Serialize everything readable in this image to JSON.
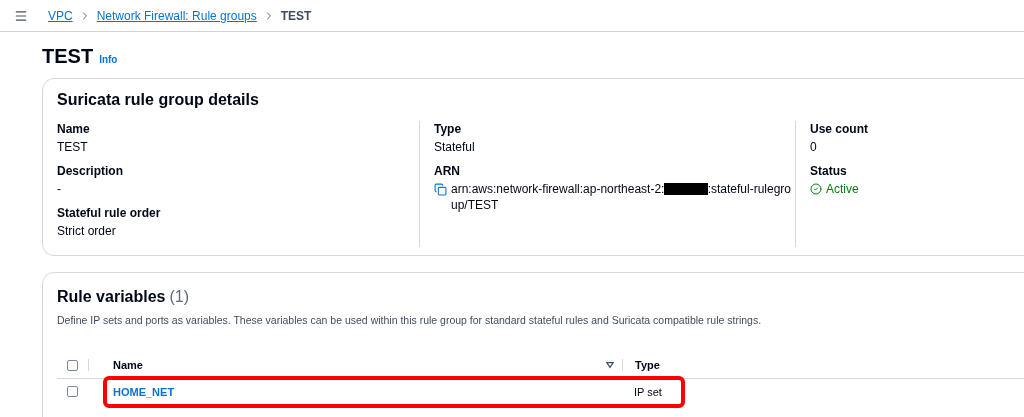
{
  "breadcrumbs": [
    {
      "label": "VPC",
      "kind": "link"
    },
    {
      "label": "Network Firewall: Rule groups",
      "kind": "link"
    },
    {
      "label": "TEST",
      "kind": "current"
    }
  ],
  "page": {
    "title": "TEST",
    "info": "Info"
  },
  "details": {
    "title": "Suricata rule group details",
    "columns": [
      [
        {
          "label": "Name",
          "value": "TEST"
        },
        {
          "label": "Description",
          "value": "-"
        },
        {
          "label": "Stateful rule order",
          "value": "Strict order"
        }
      ],
      [
        {
          "label": "Type",
          "value": "Stateful"
        },
        {
          "label": "ARN",
          "kind": "arn",
          "prefix": "arn:aws:network-firewall:ap-northeast-2:",
          "redacted": true,
          "suffix": ":stateful-rulegro",
          "continuation": "up/TEST"
        }
      ],
      [
        {
          "label": "Use count",
          "value": "0"
        },
        {
          "label": "Status",
          "kind": "status",
          "value": "Active"
        }
      ]
    ]
  },
  "variables": {
    "title": "Rule variables",
    "count": "(1)",
    "description": "Define IP sets and ports as variables. These variables can be used within this rule group for standard stateful rules and Suricata compatible rule strings.",
    "columns": [
      "Name",
      "Type"
    ],
    "all_checked": false,
    "rows": [
      {
        "name": "HOME_NET",
        "type": "IP set",
        "checked": false,
        "highlighted": true
      }
    ]
  }
}
